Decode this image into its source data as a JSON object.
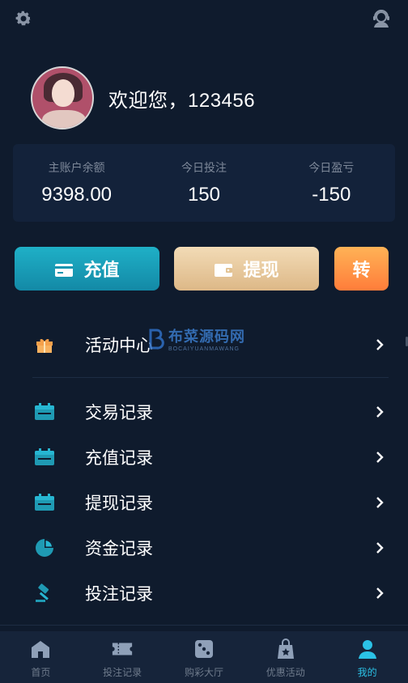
{
  "header": {
    "settings_icon": "gear-icon",
    "service_icon": "customer-service-icon"
  },
  "profile": {
    "greeting": "欢迎您，123456"
  },
  "stats": [
    {
      "label": "主账户余额",
      "value": "9398.00"
    },
    {
      "label": "今日投注",
      "value": "150"
    },
    {
      "label": "今日盈亏",
      "value": "-150"
    }
  ],
  "actions": {
    "recharge": "充值",
    "withdraw": "提现",
    "transfer": "转"
  },
  "menu": [
    {
      "label": "活动中心",
      "icon": "gift-icon"
    },
    {
      "label": "交易记录",
      "icon": "calendar-icon"
    },
    {
      "label": "充值记录",
      "icon": "calendar-icon"
    },
    {
      "label": "提现记录",
      "icon": "calendar-icon"
    },
    {
      "label": "资金记录",
      "icon": "pie-chart-icon"
    },
    {
      "label": "投注记录",
      "icon": "gavel-icon"
    }
  ],
  "watermark": {
    "title": "布菜源码网",
    "subtitle": "BOCAIYUANMAWANG"
  },
  "nav": [
    {
      "label": "首页",
      "icon": "home-icon"
    },
    {
      "label": "投注记录",
      "icon": "ticket-icon"
    },
    {
      "label": "购彩大厅",
      "icon": "dice-icon"
    },
    {
      "label": "优惠活动",
      "icon": "gift-bag-icon"
    },
    {
      "label": "我的",
      "icon": "user-icon"
    }
  ],
  "colors": {
    "accent": "#2bc2e6",
    "background": "#0f1b2d",
    "recharge": "#1fb0c7",
    "withdraw": "#e8cba0",
    "transfer": "#ff9a45"
  }
}
